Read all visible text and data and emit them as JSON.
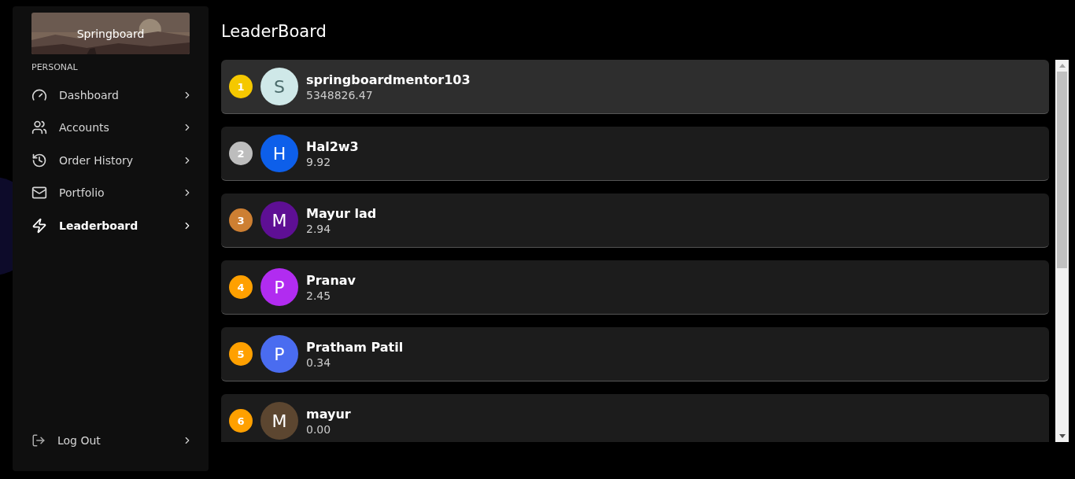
{
  "sidebar": {
    "banner": {
      "title": "Springboard"
    },
    "section": "PERSONAL",
    "items": [
      {
        "label": "Dashboard",
        "selected": false
      },
      {
        "label": "Accounts",
        "selected": false
      },
      {
        "label": "Order History",
        "selected": false
      },
      {
        "label": "Portfolio",
        "selected": false
      },
      {
        "label": "Leaderboard",
        "selected": true
      }
    ],
    "logout": {
      "label": "Log Out"
    }
  },
  "page": {
    "title": "LeaderBoard"
  },
  "leaderboard": [
    {
      "rank": {
        "text": "1",
        "color": "#f5c800"
      },
      "avatar": {
        "initial": "S",
        "color": "#cfe8e8"
      },
      "name": "springboardmentor103",
      "score": "5348826.47",
      "selected": true
    },
    {
      "rank": {
        "text": "2",
        "color": "#bdbdbd"
      },
      "avatar": {
        "initial": "H",
        "color": "#0d5fea"
      },
      "name": "Hal2w3",
      "score": "9.92",
      "selected": false
    },
    {
      "rank": {
        "text": "3",
        "color": "#cd7f32"
      },
      "avatar": {
        "initial": "M",
        "color": "#5e0f94"
      },
      "name": "Mayur lad",
      "score": "2.94",
      "selected": false
    },
    {
      "rank": {
        "text": "4",
        "color": "#ffa000"
      },
      "avatar": {
        "initial": "P",
        "color": "#b12cf0"
      },
      "name": "Pranav",
      "score": "2.45",
      "selected": false
    },
    {
      "rank": {
        "text": "5",
        "color": "#ffa000"
      },
      "avatar": {
        "initial": "P",
        "color": "#4a6cf0"
      },
      "name": "Pratham Patil",
      "score": "0.34",
      "selected": false
    },
    {
      "rank": {
        "text": "6",
        "color": "#ffa000"
      },
      "avatar": {
        "initial": "M",
        "color": "#5c4630"
      },
      "name": "mayur",
      "score": "0.00",
      "selected": false
    }
  ]
}
